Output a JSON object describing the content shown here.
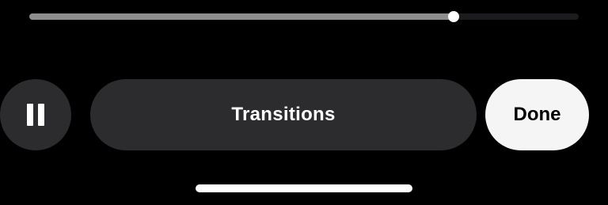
{
  "playback": {
    "progress": 0.772
  },
  "controls": {
    "pause_icon": "pause-icon",
    "transitions_label": "Transitions",
    "done_label": "Done"
  },
  "colors": {
    "background": "#000000",
    "button_dark": "#2c2c2e",
    "button_light": "#f5f5f5",
    "track": "#1c1c1e",
    "progress_fill": "#8e8e8e",
    "knob": "#ffffff"
  }
}
